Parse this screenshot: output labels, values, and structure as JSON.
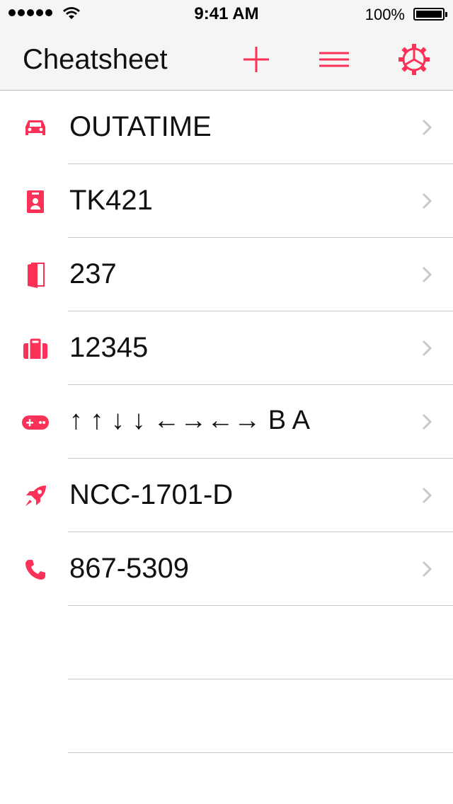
{
  "status_bar": {
    "time": "9:41 AM",
    "battery_percent": "100%"
  },
  "nav": {
    "title": "Cheatsheet",
    "add_icon": "plus-icon",
    "menu_icon": "hamburger-icon",
    "settings_icon": "gear-icon"
  },
  "colors": {
    "accent": "#fc3158",
    "chevron": "#c7c7cc",
    "separator": "#c8c8cc"
  },
  "items": [
    {
      "icon": "car-icon",
      "text": "OUTATIME"
    },
    {
      "icon": "id-badge-icon",
      "text": "TK421"
    },
    {
      "icon": "door-icon",
      "text": "237"
    },
    {
      "icon": "suitcase-icon",
      "text": "12345"
    },
    {
      "icon": "gamepad-icon",
      "text": "↑ ↑ ↓ ↓ ←→←→ B A"
    },
    {
      "icon": "rocket-icon",
      "text": "NCC-1701-D"
    },
    {
      "icon": "phone-icon",
      "text": "867-5309"
    }
  ]
}
